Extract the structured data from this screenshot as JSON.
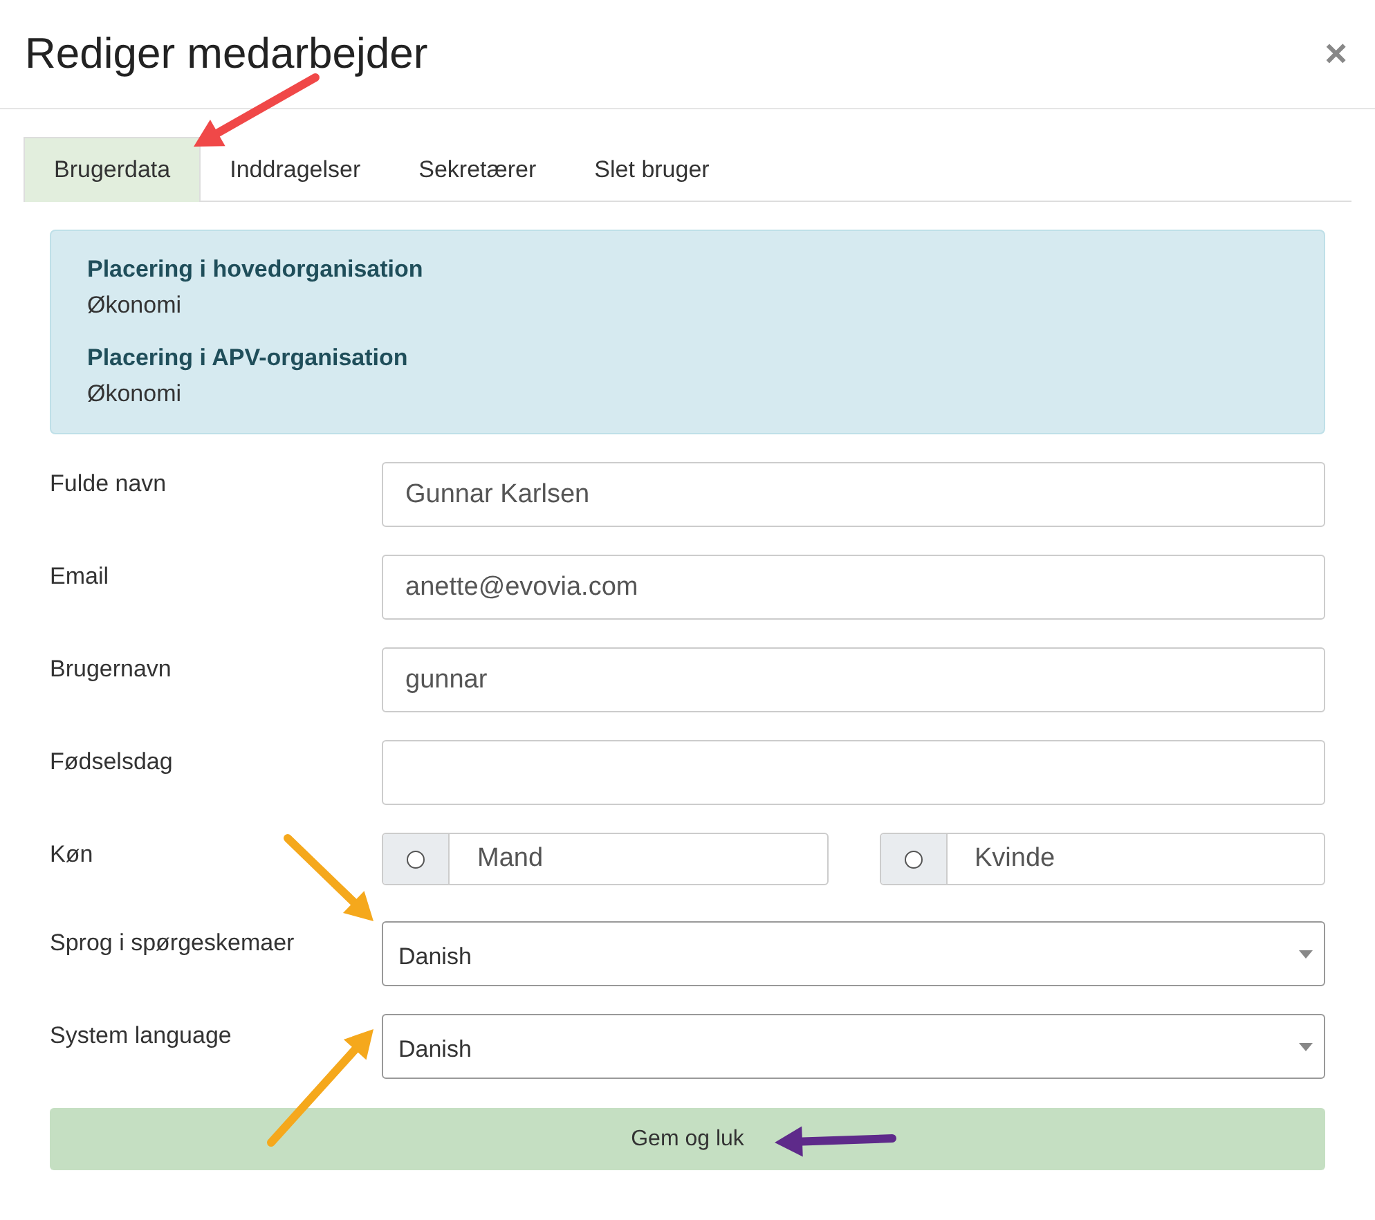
{
  "dialog": {
    "title": "Rediger medarbejder",
    "close": "×"
  },
  "tabs": [
    {
      "label": "Brugerdata",
      "selected": true
    },
    {
      "label": "Inddragelser",
      "selected": false
    },
    {
      "label": "Sekretærer",
      "selected": false
    },
    {
      "label": "Slet bruger",
      "selected": false
    }
  ],
  "info": [
    {
      "heading": "Placering i hovedorganisation",
      "value": "Økonomi"
    },
    {
      "heading": "Placering i APV-organisation",
      "value": "Økonomi"
    }
  ],
  "fields": [
    {
      "kind": "text",
      "label": "Fulde navn",
      "value": "Gunnar Karlsen"
    },
    {
      "kind": "text",
      "label": "Email",
      "value": "anette@evovia.com"
    },
    {
      "kind": "text",
      "label": "Brugernavn",
      "value": "gunnar"
    },
    {
      "kind": "text",
      "label": "Fødselsdag"
    },
    {
      "kind": "radio",
      "label": "Køn",
      "options": [
        {
          "label": "Mand",
          "checked": false
        },
        {
          "label": "Kvinde",
          "checked": false
        }
      ]
    },
    {
      "kind": "select",
      "label": "Sprog i spørgeskemaer",
      "value": "Danish"
    },
    {
      "kind": "select",
      "label": "System language",
      "value": "Danish"
    }
  ],
  "save_button": "Gem og luk",
  "annotations": [
    {
      "kind": "arrow",
      "color": "#f04848"
    },
    {
      "kind": "arrow",
      "color": "#f5a81c"
    },
    {
      "kind": "arrow",
      "color": "#f5a81c"
    },
    {
      "kind": "arrow",
      "color": "#5e2a8a"
    }
  ]
}
